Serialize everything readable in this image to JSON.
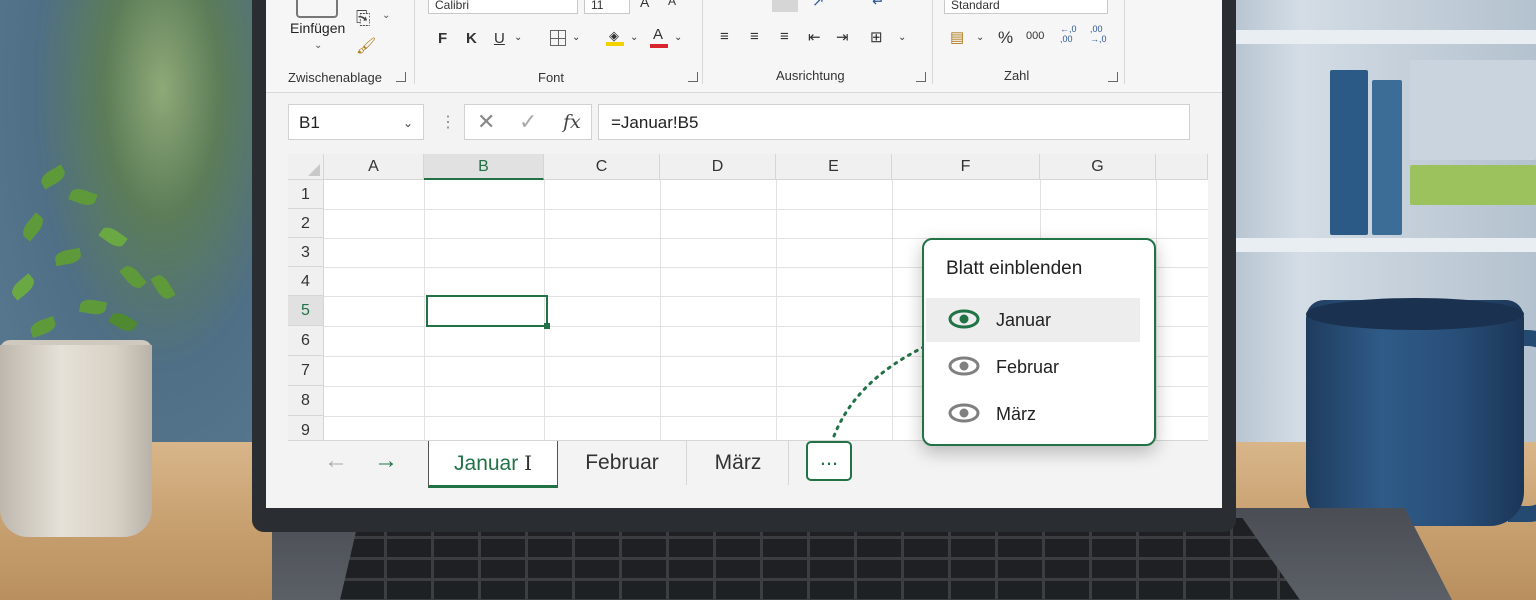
{
  "ribbon": {
    "paste_label": "Einfügen",
    "font_name": "Calibri",
    "font_size": "11",
    "alignment_group_label": "Ausrichtung",
    "font_group_label": "Font",
    "clipboard_group_label": "Zwischenablage",
    "number_format": "Standard",
    "number_group_label": "Zahl",
    "bold": "F",
    "italic": "K",
    "underline": "U",
    "percent": "%",
    "thousands": "000",
    "inc_decimal": "←,0\n,00",
    "dec_decimal": ",00\n→,0",
    "accent": "#217346"
  },
  "formula_bar": {
    "name_box": "B1",
    "fx_label": "fx",
    "formula": "=Januar!B5"
  },
  "sheet": {
    "columns": [
      "A",
      "B",
      "C",
      "D",
      "E",
      "F",
      "G"
    ],
    "rows": [
      "1",
      "2",
      "3",
      "4",
      "5",
      "6",
      "7",
      "8",
      "9"
    ],
    "selected_column": "B",
    "selected_row": "5"
  },
  "tabs": {
    "items": [
      "Januar",
      "Februar",
      "März"
    ],
    "active": "Januar",
    "more_label": "..."
  },
  "popup": {
    "title": "Blatt einblenden",
    "items": [
      {
        "label": "Januar",
        "icon": "eye-icon",
        "highlighted": true
      },
      {
        "label": "Februar",
        "icon": "eye-icon",
        "highlighted": false
      },
      {
        "label": "März",
        "icon": "eye-icon",
        "highlighted": false
      }
    ]
  }
}
